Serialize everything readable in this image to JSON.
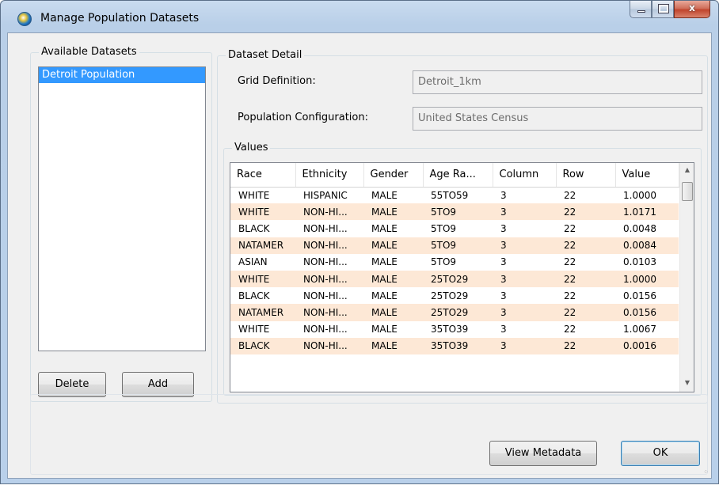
{
  "window": {
    "title": "Manage Population Datasets",
    "icon": "globe-app-icon",
    "close_glyph": "x"
  },
  "available_datasets": {
    "title": "Available Datasets",
    "items": [
      "Detroit Population"
    ],
    "selected_index": 0,
    "delete_label": "Delete",
    "add_label": "Add"
  },
  "dataset_detail": {
    "title": "Dataset Detail",
    "grid_definition_label": "Grid Definition:",
    "grid_definition_value": "Detroit_1km",
    "population_config_label": "Population Configuration:",
    "population_config_value": "United States Census"
  },
  "values": {
    "title": "Values",
    "columns": [
      "Race",
      "Ethnicity",
      "Gender",
      "Age Ra...",
      "Column",
      "Row",
      "Value"
    ],
    "rows": [
      [
        "WHITE",
        "HISPANIC",
        "MALE",
        "55TO59",
        "3",
        "22",
        "1.0000"
      ],
      [
        "WHITE",
        "NON-HI...",
        "MALE",
        "5TO9",
        "3",
        "22",
        "1.0171"
      ],
      [
        "BLACK",
        "NON-HI...",
        "MALE",
        "5TO9",
        "3",
        "22",
        "0.0048"
      ],
      [
        "NATAMER",
        "NON-HI...",
        "MALE",
        "5TO9",
        "3",
        "22",
        "0.0084"
      ],
      [
        "ASIAN",
        "NON-HI...",
        "MALE",
        "5TO9",
        "3",
        "22",
        "0.0103"
      ],
      [
        "WHITE",
        "NON-HI...",
        "MALE",
        "25TO29",
        "3",
        "22",
        "1.0000"
      ],
      [
        "BLACK",
        "NON-HI...",
        "MALE",
        "25TO29",
        "3",
        "22",
        "0.0156"
      ],
      [
        "NATAMER",
        "NON-HI...",
        "MALE",
        "25TO29",
        "3",
        "22",
        "0.0156"
      ],
      [
        "WHITE",
        "NON-HI...",
        "MALE",
        "35TO39",
        "3",
        "22",
        "1.0067"
      ],
      [
        "BLACK",
        "NON-HI...",
        "MALE",
        "35TO39",
        "3",
        "22",
        "0.0016"
      ]
    ]
  },
  "footer": {
    "view_metadata_label": "View Metadata",
    "ok_label": "OK"
  },
  "colors": {
    "selection": "#3399ff",
    "alt_row": "#fde8d6"
  }
}
